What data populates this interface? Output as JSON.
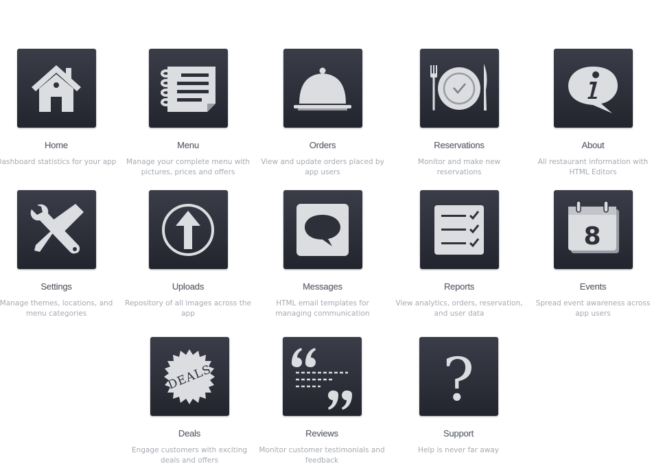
{
  "tiles": [
    {
      "title": "Home",
      "desc": "Dashboard statistics for your app",
      "icon": "house-icon"
    },
    {
      "title": "Menu",
      "desc": "Manage your complete menu with pictures, prices and offers",
      "icon": "menu-card-icon"
    },
    {
      "title": "Orders",
      "desc": "View and update orders placed by app users",
      "icon": "cloche-icon"
    },
    {
      "title": "Reservations",
      "desc": "Monitor and make new reservations",
      "icon": "plate-cutlery-icon"
    },
    {
      "title": "About",
      "desc": "All restaurant information with HTML Editors",
      "icon": "info-bubble-icon"
    },
    {
      "title": "Settings",
      "desc": "Manage themes, locations, and menu categories",
      "icon": "wrench-screwdriver-icon"
    },
    {
      "title": "Uploads",
      "desc": "Repository of all images across the app",
      "icon": "upload-arrow-icon"
    },
    {
      "title": "Messages",
      "desc": "HTML email templates for managing communication",
      "icon": "chat-bubble-icon"
    },
    {
      "title": "Reports",
      "desc": "View analytics, orders, reservation, and user data",
      "icon": "checklist-icon"
    },
    {
      "title": "Events",
      "desc": "Spread event awareness across app users",
      "icon": "calendar-icon"
    },
    {
      "title": "Deals",
      "desc": "Engage customers with exciting deals and offers",
      "icon": "deals-badge-icon"
    },
    {
      "title": "Reviews",
      "desc": "Monitor customer testimonials and feedback",
      "icon": "quote-icon"
    },
    {
      "title": "Support",
      "desc": "Help is never far away",
      "icon": "question-mark-icon"
    }
  ],
  "icon_text": {
    "deals_badge": "DEALS",
    "calendar_day": "8",
    "support_glyph": "?"
  }
}
